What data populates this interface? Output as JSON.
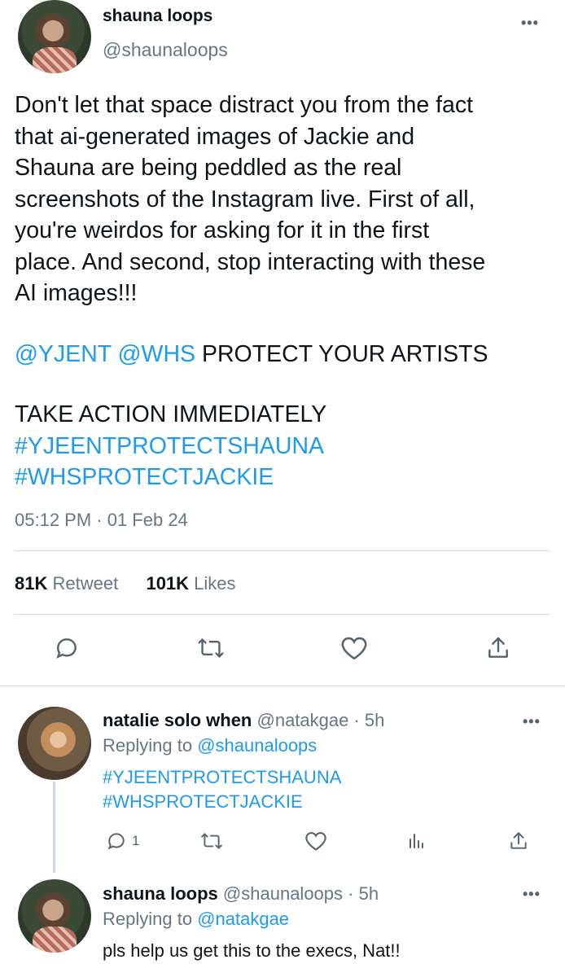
{
  "main_tweet": {
    "name": "shauna loops",
    "handle": "@shaunaloops",
    "more": "•••",
    "lines": [
      "Don't let that space distract you from the fact",
      "that ai-generated images of Jackie and",
      "Shauna are being peddled as the real",
      "screenshots of the Instagram live. First of all,",
      "you're weirdos for asking for it in the first",
      "place. And second, stop interacting with these",
      "AI images!!!"
    ],
    "mention1": "@YJENT",
    "mention2": "@WHS",
    "protect_text": " PROTECT YOUR ARTISTS",
    "action_text": "TAKE ACTION IMMEDIATELY",
    "hashtag1": "#YJEENTPROTECTSHAUNA",
    "hashtag2": "#WHSPROTECTJACKIE",
    "timestamp": "05:12 PM · 01 Feb 24",
    "retweets_count": "81K",
    "retweets_label": "Retweet",
    "likes_count": "101K",
    "likes_label": "Likes",
    "icons": [
      "reply-icon",
      "retweet-icon",
      "like-icon",
      "share-icon"
    ]
  },
  "replies": [
    {
      "name": "natalie solo when",
      "handle": "@natakgae",
      "time": " · 5h",
      "replying_label": "Replying to ",
      "replying_to": "@shaunaloops",
      "hashtag1": "#YJEENTPROTECTSHAUNA",
      "hashtag2": "#WHSPROTECTJACKIE",
      "reply_count": "1",
      "more": "•••",
      "icons": [
        "reply-icon",
        "retweet-icon",
        "like-icon",
        "analytics-icon",
        "share-icon"
      ]
    },
    {
      "name": "shauna loops",
      "handle": "@shaunaloops",
      "time": " · 5h",
      "replying_label": "Replying to ",
      "replying_to": "@natakgae",
      "text": "pls help us get this to the execs, Nat!!",
      "more": "•••"
    }
  ]
}
